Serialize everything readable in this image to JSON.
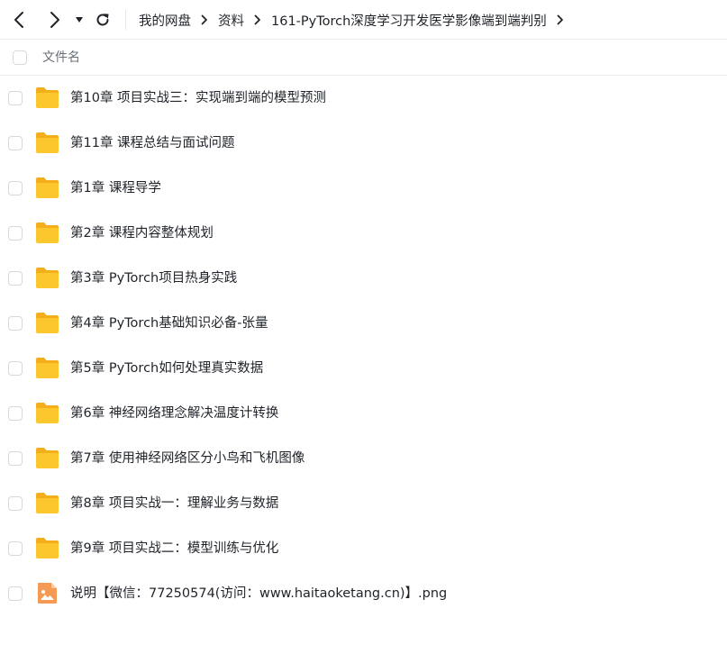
{
  "toolbar": {
    "back_icon": "chevron-left-icon",
    "forward_icon": "chevron-right-icon",
    "history_icon": "caret-down-icon",
    "refresh_icon": "refresh-icon"
  },
  "breadcrumb": {
    "items": [
      "我的网盘",
      "资料",
      "161-PyTorch深度学习开发医学影像端到端判别"
    ]
  },
  "list_header": {
    "name_column": "文件名"
  },
  "files": [
    {
      "name": "第10章 项目实战三：实现端到端的模型预测",
      "type": "folder"
    },
    {
      "name": "第11章 课程总结与面试问题",
      "type": "folder"
    },
    {
      "name": "第1章 课程导学",
      "type": "folder"
    },
    {
      "name": "第2章 课程内容整体规划",
      "type": "folder"
    },
    {
      "name": "第3章 PyTorch项目热身实践",
      "type": "folder"
    },
    {
      "name": "第4章 PyTorch基础知识必备-张量",
      "type": "folder"
    },
    {
      "name": "第5章 PyTorch如何处理真实数据",
      "type": "folder"
    },
    {
      "name": "第6章 神经网络理念解决温度计转换",
      "type": "folder"
    },
    {
      "name": "第7章 使用神经网络区分小鸟和飞机图像",
      "type": "folder"
    },
    {
      "name": "第8章 项目实战一：理解业务与数据",
      "type": "folder"
    },
    {
      "name": "第9章 项目实战二：模型训练与优化",
      "type": "folder"
    },
    {
      "name": "说明【微信：77250574(访问：www.haitaoketang.cn)】.png",
      "type": "image"
    }
  ],
  "colors": {
    "folder": "#fcc72c",
    "folder_back": "#f5ae1b",
    "image_icon": "#f59a55"
  }
}
